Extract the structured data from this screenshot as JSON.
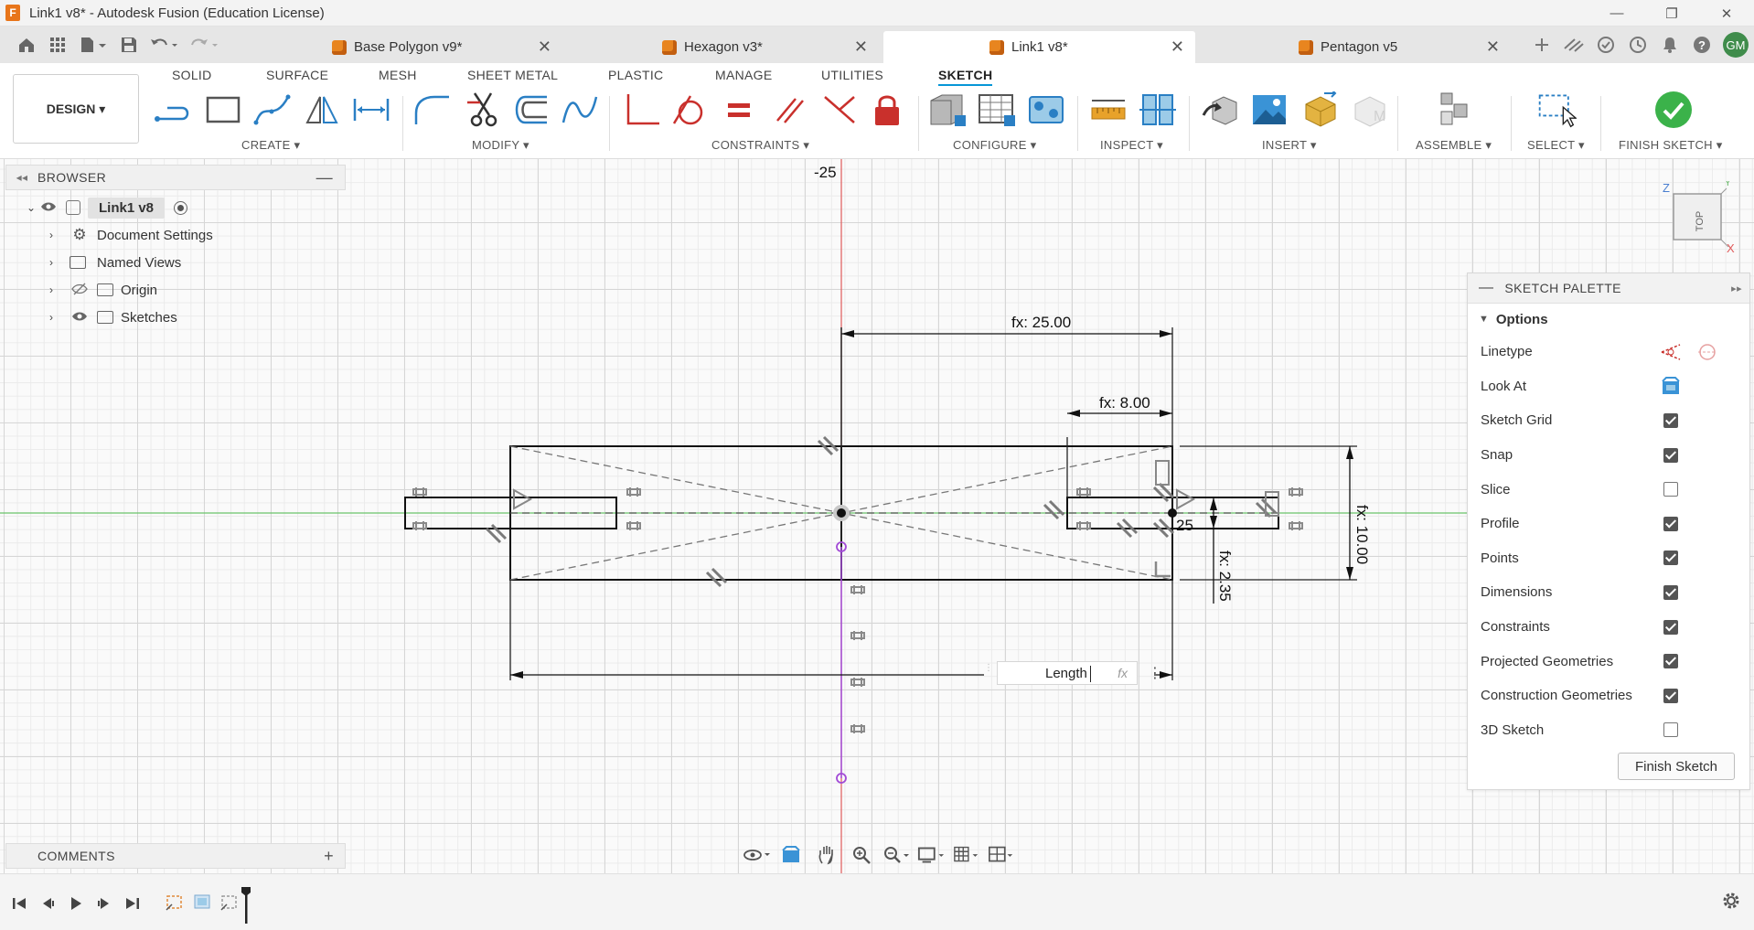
{
  "window": {
    "title": "Link1 v8* - Autodesk Fusion (Education License)",
    "logo_letter": "F",
    "minimize": "—",
    "restore": "❐",
    "close": "✕"
  },
  "tabs": [
    {
      "label": "Base Polygon v9*",
      "close": "✕"
    },
    {
      "label": "Hexagon v3*",
      "close": "✕"
    },
    {
      "label": "Link1 v8*",
      "close": "✕"
    },
    {
      "label": "Pentagon v5",
      "close": "✕"
    }
  ],
  "user": {
    "initials": "GM"
  },
  "ribbon": {
    "workspace": "DESIGN ▾",
    "tabs": [
      "SOLID",
      "SURFACE",
      "MESH",
      "SHEET METAL",
      "PLASTIC",
      "MANAGE",
      "UTILITIES",
      "SKETCH"
    ],
    "active_tab": "SKETCH",
    "groups": {
      "create": "CREATE ▾",
      "modify": "MODIFY ▾",
      "constraints": "CONSTRAINTS ▾",
      "configure": "CONFIGURE ▾",
      "inspect": "INSPECT ▾",
      "insert": "INSERT ▾",
      "assemble": "ASSEMBLE ▾",
      "select": "SELECT ▾",
      "finish": "FINISH SKETCH ▾"
    }
  },
  "browser": {
    "title": "BROWSER",
    "collapse": "◂◂",
    "minimize": "—",
    "root": "Link1 v8",
    "items": [
      {
        "label": "Document Settings"
      },
      {
        "label": "Named Views"
      },
      {
        "label": "Origin"
      },
      {
        "label": "Sketches"
      }
    ]
  },
  "palette": {
    "title": "SKETCH PALETTE",
    "section": "Options",
    "rows": [
      {
        "label": "Linetype",
        "kind": "icons"
      },
      {
        "label": "Look At",
        "kind": "icon"
      },
      {
        "label": "Sketch Grid",
        "checked": true
      },
      {
        "label": "Snap",
        "checked": true
      },
      {
        "label": "Slice",
        "checked": false
      },
      {
        "label": "Profile",
        "checked": true
      },
      {
        "label": "Points",
        "checked": true
      },
      {
        "label": "Dimensions",
        "checked": true
      },
      {
        "label": "Constraints",
        "checked": true
      },
      {
        "label": "Projected Geometries",
        "checked": true
      },
      {
        "label": "Construction Geometries",
        "checked": true
      },
      {
        "label": "3D Sketch",
        "checked": false
      }
    ],
    "finish_button": "Finish Sketch"
  },
  "comments": {
    "title": "COMMENTS",
    "add": "+"
  },
  "sketch": {
    "axis_label": "-25",
    "dims": {
      "width_total": "fx: 25.00",
      "slot_offset": "fx: 8.00",
      "height": "fx: 10.00",
      "slot_height": "fx: 2.35",
      "small": "25"
    },
    "length_input": {
      "value": "Length",
      "fx": "fx",
      "menu": "⋮"
    }
  },
  "viewcube": {
    "face": "TOP",
    "axis_z": "Z",
    "axis_x": "X",
    "axis_y": "Y"
  },
  "colors": {
    "accent": "#0696d7",
    "finish_green": "#3bb24a",
    "constraint_red": "#c9302c",
    "origin_purple": "#a24ad6",
    "axis_green": "#6ac46a",
    "axis_red": "#e05a5a"
  }
}
